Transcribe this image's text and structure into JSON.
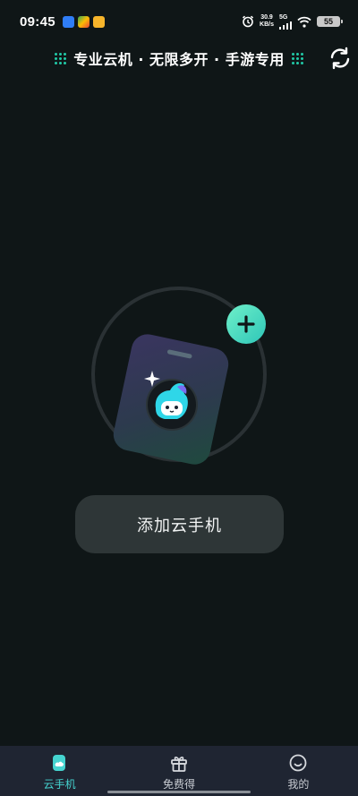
{
  "status_bar": {
    "time": "09:45",
    "net_speed_value": "30.9",
    "net_speed_unit": "KB/s",
    "network_gen": "5G",
    "battery": "55",
    "notification_icons": [
      "gallery-app-icon",
      "play-store-icon",
      "yellow-app-icon"
    ]
  },
  "header": {
    "banner_text": "专业云机 · 无限多开 · 手游专用",
    "accent_color": "#21c9a6"
  },
  "main": {
    "add_button_label": "添加云手机"
  },
  "bottom_nav": {
    "items": [
      {
        "label": "云手机",
        "icon": "cloud-phone-icon",
        "active": true
      },
      {
        "label": "免费得",
        "icon": "gift-icon",
        "active": false
      },
      {
        "label": "我的",
        "icon": "smiley-profile-icon",
        "active": false
      }
    ],
    "active_color": "#45d4d0"
  }
}
